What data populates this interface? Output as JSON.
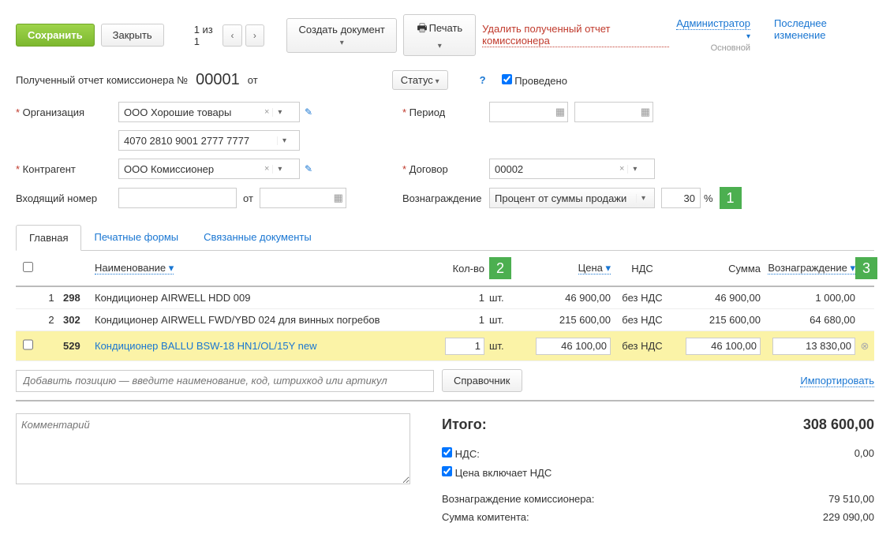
{
  "toolbar": {
    "save": "Сохранить",
    "close": "Закрыть",
    "pager": "1 из 1",
    "create_doc": "Создать документ",
    "print": "Печать",
    "delete": "Удалить полученный отчет комиссионера",
    "user": "Администратор",
    "user_role": "Основной",
    "last_change": "Последнее изменение"
  },
  "doc": {
    "title": "Полученный отчет комиссионера №",
    "number": "00001",
    "from": "от",
    "status": "Статус",
    "posted": "Проведено"
  },
  "form": {
    "org_label": "Организация",
    "org_value": "ООО Хорошие товары",
    "org_account": "4070 2810 9001 2777 7777",
    "period_label": "Период",
    "contractor_label": "Контрагент",
    "contractor_value": "ООО Комиссионер",
    "contract_label": "Договор",
    "contract_value": "00002",
    "incoming_label": "Входящий номер",
    "incoming_from": "от",
    "reward_label": "Вознаграждение",
    "reward_type": "Процент от суммы продажи",
    "reward_percent": "30",
    "percent_sign": "%"
  },
  "tabs": {
    "main": "Главная",
    "print_forms": "Печатные формы",
    "linked": "Связанные документы"
  },
  "grid": {
    "name": "Наименование",
    "qty": "Кол-во",
    "price": "Цена",
    "vat": "НДС",
    "sum": "Сумма",
    "commission": "Вознаграждение",
    "rows": [
      {
        "idx": "1",
        "code": "298",
        "name": "Кондиционер AIRWELL HDD 009",
        "qty": "1",
        "unit": "шт.",
        "price": "46 900,00",
        "vat": "без НДС",
        "sum": "46 900,00",
        "comm": "1 000,00"
      },
      {
        "idx": "2",
        "code": "302",
        "name": "Кондиционер AIRWELL FWD/YBD 024 для винных погребов",
        "qty": "1",
        "unit": "шт.",
        "price": "215 600,00",
        "vat": "без НДС",
        "sum": "215 600,00",
        "comm": "64 680,00"
      },
      {
        "idx": "",
        "code": "529",
        "name": "Кондиционер BALLU BSW-18 HN1/OL/15Y new",
        "qty": "1",
        "unit": "шт.",
        "price": "46 100,00",
        "vat": "без НДС",
        "sum": "46 100,00",
        "comm": "13 830,00"
      }
    ],
    "add_placeholder": "Добавить позицию — введите наименование, код, штрихкод или артикул",
    "directory": "Справочник",
    "import": "Импортировать"
  },
  "totals": {
    "comment_placeholder": "Комментарий",
    "total_label": "Итого:",
    "total_value": "308 600,00",
    "vat_label": "НДС:",
    "vat_value": "0,00",
    "price_incl": "Цена включает НДС",
    "commission_label": "Вознаграждение комиссионера:",
    "commission_value": "79 510,00",
    "committent_label": "Сумма комитента:",
    "committent_value": "229 090,00"
  },
  "badges": {
    "b1": "1",
    "b2": "2",
    "b3": "3"
  }
}
